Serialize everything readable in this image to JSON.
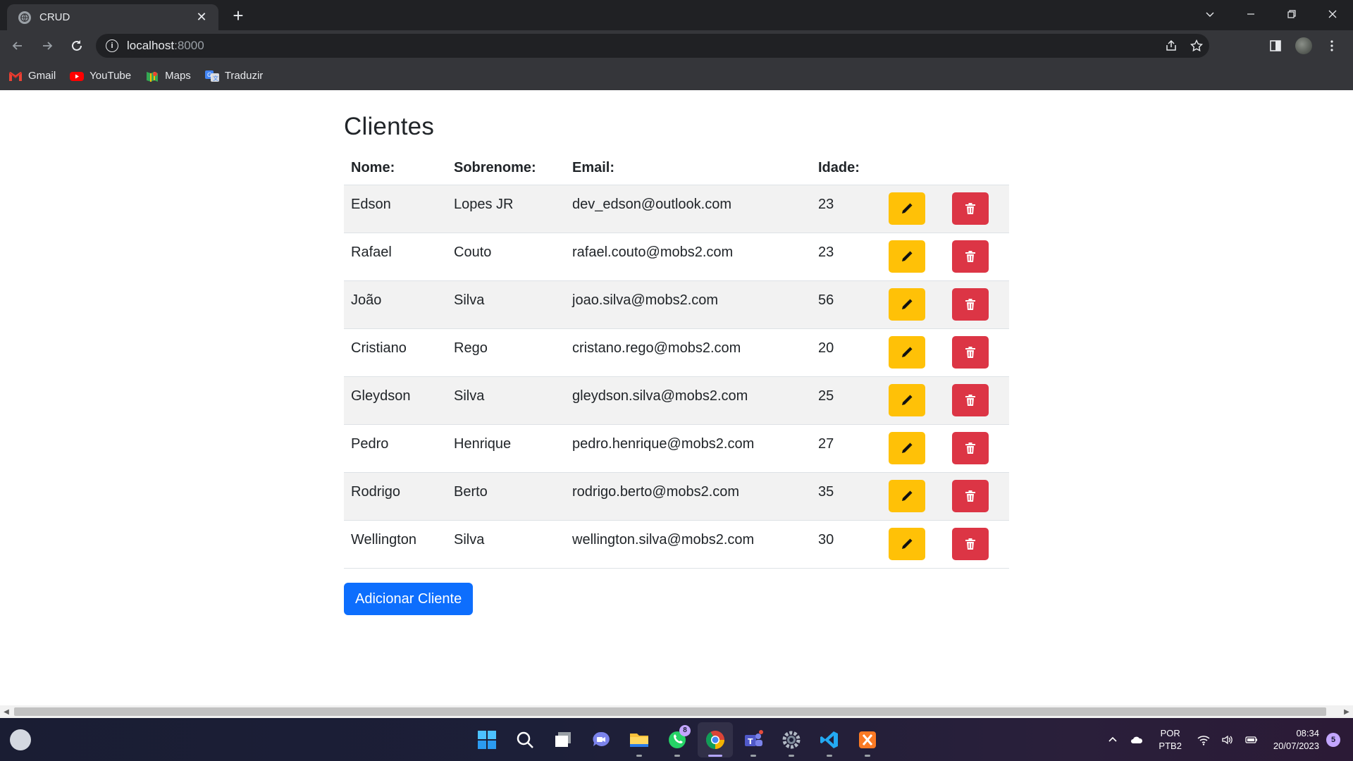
{
  "browser": {
    "tab_title": "CRUD",
    "url_host": "localhost",
    "url_port": ":8000",
    "bookmarks": [
      {
        "label": "Gmail",
        "icon": "gmail-icon"
      },
      {
        "label": "YouTube",
        "icon": "youtube-icon"
      },
      {
        "label": "Maps",
        "icon": "maps-icon"
      },
      {
        "label": "Traduzir",
        "icon": "translate-icon"
      }
    ]
  },
  "page": {
    "title": "Clientes",
    "columns": [
      "Nome:",
      "Sobrenome:",
      "Email:",
      "Idade:"
    ],
    "rows": [
      {
        "nome": "Edson",
        "sobrenome": "Lopes JR",
        "email": "dev_edson@outlook.com",
        "idade": "23"
      },
      {
        "nome": "Rafael",
        "sobrenome": "Couto",
        "email": "rafael.couto@mobs2.com",
        "idade": "23"
      },
      {
        "nome": "João",
        "sobrenome": "Silva",
        "email": "joao.silva@mobs2.com",
        "idade": "56"
      },
      {
        "nome": "Cristiano",
        "sobrenome": "Rego",
        "email": "cristano.rego@mobs2.com",
        "idade": "20"
      },
      {
        "nome": "Gleydson",
        "sobrenome": "Silva",
        "email": "gleydson.silva@mobs2.com",
        "idade": "25"
      },
      {
        "nome": "Pedro",
        "sobrenome": "Henrique",
        "email": "pedro.henrique@mobs2.com",
        "idade": "27"
      },
      {
        "nome": "Rodrigo",
        "sobrenome": "Berto",
        "email": "rodrigo.berto@mobs2.com",
        "idade": "35"
      },
      {
        "nome": "Wellington",
        "sobrenome": "Silva",
        "email": "wellington.silva@mobs2.com",
        "idade": "30"
      }
    ],
    "add_button": "Adicionar Cliente",
    "colors": {
      "edit": "#ffc107",
      "delete": "#dc3545",
      "primary": "#0d6efd"
    }
  },
  "taskbar": {
    "apps": [
      "windows-start-icon",
      "search-icon",
      "task-view-icon",
      "chat-icon",
      "file-explorer-icon",
      "whatsapp-icon",
      "chrome-icon",
      "teams-icon",
      "settings-icon",
      "vscode-icon",
      "xampp-icon"
    ],
    "whatsapp_badge": "8",
    "lang_line1": "POR",
    "lang_line2": "PTB2",
    "time": "08:34",
    "date": "20/07/2023",
    "notifications": "5"
  }
}
